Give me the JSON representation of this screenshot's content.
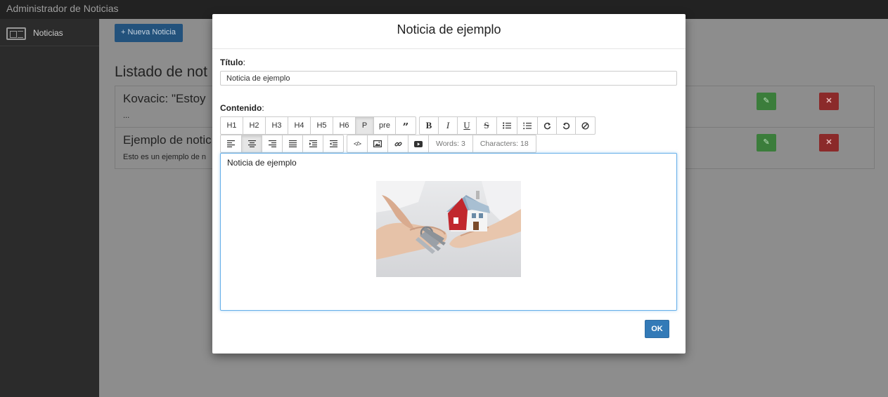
{
  "app": {
    "brand": "Administrador de Noticias"
  },
  "sidebar": {
    "items": [
      {
        "label": "Noticias",
        "icon": "newspaper-icon"
      }
    ]
  },
  "main": {
    "new_button": "+ Nueva Noticia",
    "list_title": "Listado de not",
    "rows": [
      {
        "title": "Kovacic: \"Estoy",
        "subtitle": "..."
      },
      {
        "title": "Ejemplo de notic",
        "subtitle": "Esto es un ejemplo de n"
      }
    ]
  },
  "modal": {
    "title": "Noticia de ejemplo",
    "title_label": "Título",
    "title_value": "Noticia de ejemplo",
    "content_label": "Contenido",
    "toolbar1": [
      "H1",
      "H2",
      "H3",
      "H4",
      "H5",
      "H6",
      "P",
      "pre"
    ],
    "active_block": "P",
    "words": "Words: 3",
    "characters": "Characters: 18",
    "editor_text": "Noticia de ejemplo",
    "ok_label": "OK"
  },
  "colors": {
    "primary": "#337ab7",
    "success": "#3b7d3b",
    "danger": "#8b2a2a",
    "focus": "#66afe9"
  }
}
